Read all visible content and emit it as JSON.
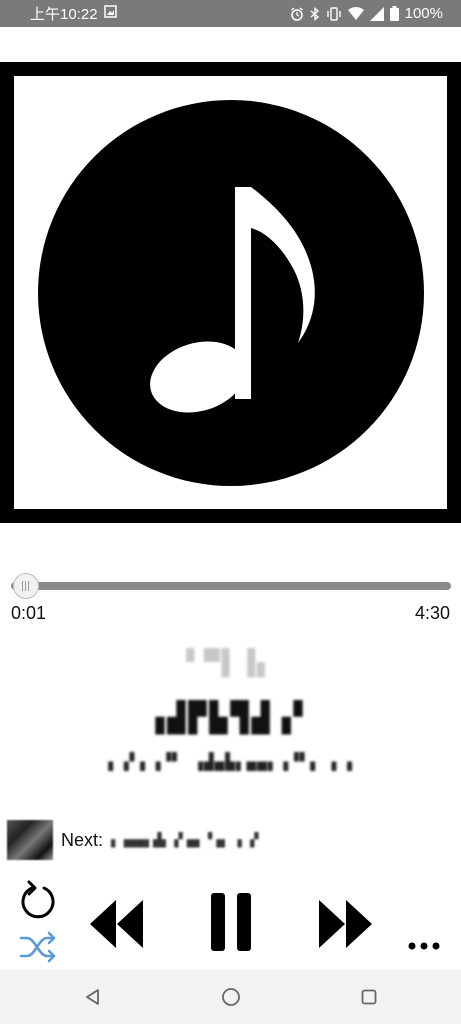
{
  "status_bar": {
    "time": "上午10:22",
    "battery": "100%",
    "icons": [
      "gallery-icon",
      "alarm-icon",
      "bluetooth-icon",
      "vibrate-icon",
      "wifi-icon",
      "signal-icon",
      "battery-icon"
    ]
  },
  "player": {
    "album_art_icon": "music-note-icon",
    "progress_fraction": 0.004,
    "elapsed": "0:01",
    "duration": "4:30",
    "line1": "▘▀▌▐▖",
    "line2": "▗▟▛▙▜▟▗▘",
    "line3": "▖▗▘▖▗▝▘ ▗▟▄▙▖▄▄▖▗▝▘▖ ▖▗",
    "next_label": "Next:",
    "next_title": "▖▗▄▄▖▟▖▗▘▄▖▝▗▖ ▖▗▘"
  },
  "controls": {
    "repeat_icon": "repeat-icon",
    "shuffle_icon": "shuffle-icon",
    "prev_icon": "rewind-icon",
    "play_pause_icon": "pause-icon",
    "next_icon": "fast-forward-icon",
    "more_icon": "more-icon",
    "shuffle_color": "#5b9bd5"
  },
  "nav": {
    "back_icon": "back-icon",
    "home_icon": "home-icon",
    "recents_icon": "recents-icon"
  }
}
